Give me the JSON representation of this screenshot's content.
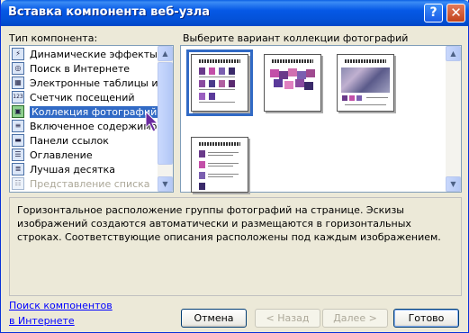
{
  "window": {
    "title": "Вставка компонента веб-узла",
    "help_label": "?",
    "close_label": "✕"
  },
  "left": {
    "label": "Тип компонента:",
    "items": [
      {
        "label": "Динамические эффекты",
        "icon": "dynamic-effects-icon",
        "glyph": "⚡"
      },
      {
        "label": "Поиск в Интернете",
        "icon": "web-search-icon",
        "glyph": "◎"
      },
      {
        "label": "Электронные таблицы и ди",
        "icon": "spreadsheet-icon",
        "glyph": "▦"
      },
      {
        "label": "Счетчик посещений",
        "icon": "hit-counter-icon",
        "glyph": "123"
      },
      {
        "label": "Коллекция фотографий",
        "icon": "photo-gallery-icon",
        "glyph": "▣"
      },
      {
        "label": "Включенное содержимое",
        "icon": "included-content-icon",
        "glyph": "≡"
      },
      {
        "label": "Панели ссылок",
        "icon": "link-bar-icon",
        "glyph": "▬"
      },
      {
        "label": "Оглавление",
        "icon": "table-of-contents-icon",
        "glyph": "☰"
      },
      {
        "label": "Лучшая десятка",
        "icon": "top-ten-icon",
        "glyph": "≣"
      },
      {
        "label": "Представление списка",
        "icon": "list-view-icon",
        "glyph": "☷"
      }
    ],
    "selected": "Коллекция фотографий",
    "disabled": "Представление списка"
  },
  "right": {
    "label": "Выберите вариант коллекции фотографий"
  },
  "description": "Горизонтальное расположение группы фотографий на странице. Эскизы изображений создаются автоматически и размещаются в горизонтальных строках. Соответствующие описания расположены под каждым изображением.",
  "find_link": {
    "line1": "Поиск компонентов",
    "line2": "в Интернете"
  },
  "buttons": {
    "cancel": "Отмена",
    "back": "< Назад",
    "next": "Далее >",
    "finish": "Готово"
  },
  "colors": {
    "selection": "#316ac5",
    "titlebar": "#0558e6",
    "dialog_bg": "#ece9d8",
    "link": "#0000ff"
  }
}
